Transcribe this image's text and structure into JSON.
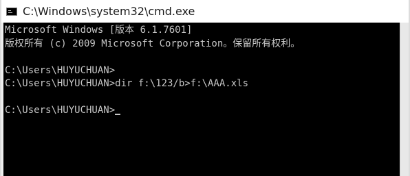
{
  "window": {
    "title": "C:\\Windows\\system32\\cmd.exe",
    "icon": "cmd-console-icon"
  },
  "console": {
    "lines": [
      "Microsoft Windows [版本 6.1.7601]",
      "版权所有 (c) 2009 Microsoft Corporation。保留所有权利。",
      "",
      "C:\\Users\\HUYUCHUAN>",
      "C:\\Users\\HUYUCHUAN>dir f:\\123/b>f:\\AAA.xls",
      "",
      "C:\\Users\\HUYUCHUAN>"
    ],
    "text_color": "#c6c6c6",
    "background": "#000000"
  }
}
